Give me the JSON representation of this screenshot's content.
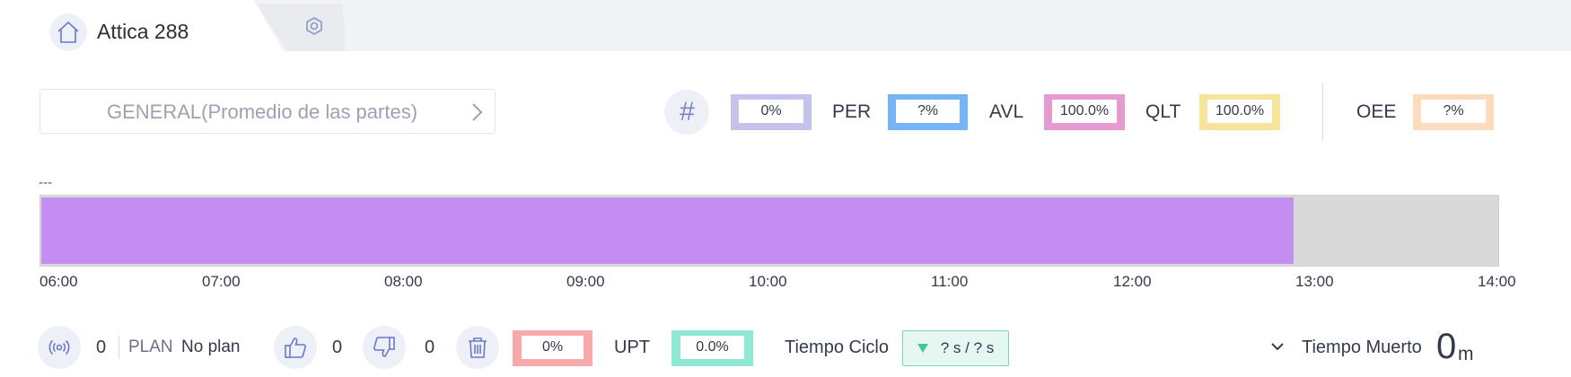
{
  "header": {
    "title": "Attica 288",
    "icons": {
      "home": "home-icon",
      "settings": "gear-icon"
    }
  },
  "selector": {
    "label": "GENERAL(Promedio de las partes)",
    "icon": "chevron-right-icon"
  },
  "metrics": {
    "count_icon": "hash-icon",
    "count_value": "0%",
    "items": [
      {
        "label": "PER",
        "value": "?%",
        "color": "#74b5f7"
      },
      {
        "label": "AVL",
        "value": "100.0%",
        "color": "#e79ad2"
      },
      {
        "label": "QLT",
        "value": "100.0%",
        "color": "#f7e39a"
      }
    ],
    "oee": {
      "label": "OEE",
      "value": "?%",
      "color": "#fcdcbd"
    },
    "count_color": "#c4c3ee"
  },
  "timeline": {
    "caption": "---",
    "progress_fraction": 0.86,
    "fill_color": "#c38df2",
    "ticks": [
      "06:00",
      "07:00",
      "08:00",
      "09:00",
      "10:00",
      "11:00",
      "12:00",
      "13:00",
      "14:00"
    ]
  },
  "status": {
    "signal_icon": "broadcast-icon",
    "signal_count": "0",
    "plan_label": "PLAN",
    "plan_value": "No plan",
    "good_icon": "thumbs-up-icon",
    "good_count": "0",
    "bad_icon": "thumbs-down-icon",
    "bad_count": "0",
    "trash_icon": "trash-icon",
    "scrap_value": "0%",
    "scrap_color": "#f8a9a9",
    "upt_label": "UPT",
    "upt_value": "0.0%",
    "upt_color": "#8fe8d2",
    "ciclo_label": "Tiempo Ciclo",
    "ciclo_value": "? s / ? s",
    "muerto_label": "Tiempo Muerto",
    "muerto_value": "0",
    "muerto_unit": "m"
  }
}
